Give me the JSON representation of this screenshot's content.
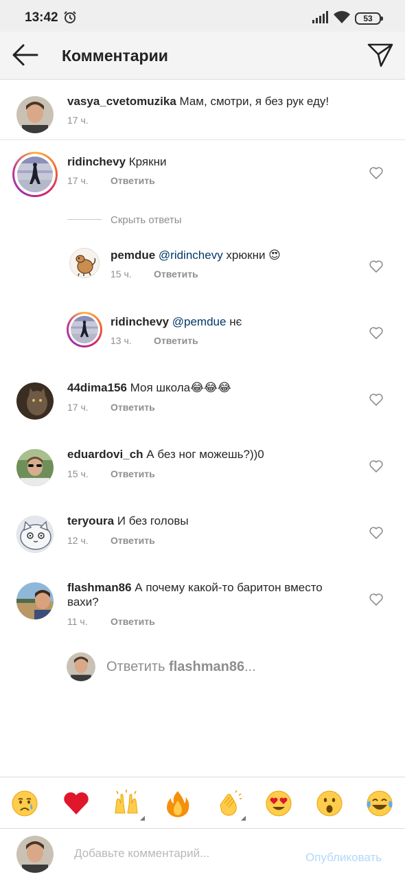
{
  "status_bar": {
    "time": "13:42",
    "battery": "53"
  },
  "header": {
    "title": "Комментарии"
  },
  "caption": {
    "username": "vasya_cvetomuzika",
    "text": " Мам, смотри, я без рук еду!",
    "time": "17 ч."
  },
  "comments": [
    {
      "username": "ridinchevy",
      "text": " Крякни",
      "time": "17 ч.",
      "reply_label": "Ответить"
    },
    {
      "username": "44dima156",
      "text": " Моя школа😂😂😂",
      "time": "17 ч.",
      "reply_label": "Ответить"
    },
    {
      "username": "eduardovi_ch",
      "text": " А без ног можешь?))0",
      "time": "15 ч.",
      "reply_label": "Ответить"
    },
    {
      "username": "teryoura",
      "text": " И без головы",
      "time": "12 ч.",
      "reply_label": "Ответить"
    },
    {
      "username": "flashman86",
      "text": " А почему какой-то баритон вместо вахи?",
      "time": "11 ч.",
      "reply_label": "Ответить"
    }
  ],
  "hide_replies": "Скрыть ответы",
  "replies": [
    {
      "username": "pemdue",
      "mention": " @ridinchevy",
      "text": " хрюкни 😍",
      "time": "15 ч.",
      "reply_label": "Ответить"
    },
    {
      "username": "ridinchevy",
      "mention": " @pemdue",
      "text": " нє",
      "time": "13 ч.",
      "reply_label": "Ответить"
    }
  ],
  "reply_prompt": {
    "prefix": "Ответить ",
    "username": "flashman86",
    "suffix": "..."
  },
  "emoji_bar": [
    "😢",
    "❤️",
    "🙌",
    "🔥",
    "👏",
    "😍",
    "😮",
    "😂"
  ],
  "input": {
    "placeholder": "Добавьте комментарий...",
    "publish_label": "Опубликовать"
  },
  "colors": {
    "mention": "#00376b",
    "secondary": "#8e8e8e",
    "publish": "#b3d7fb"
  }
}
